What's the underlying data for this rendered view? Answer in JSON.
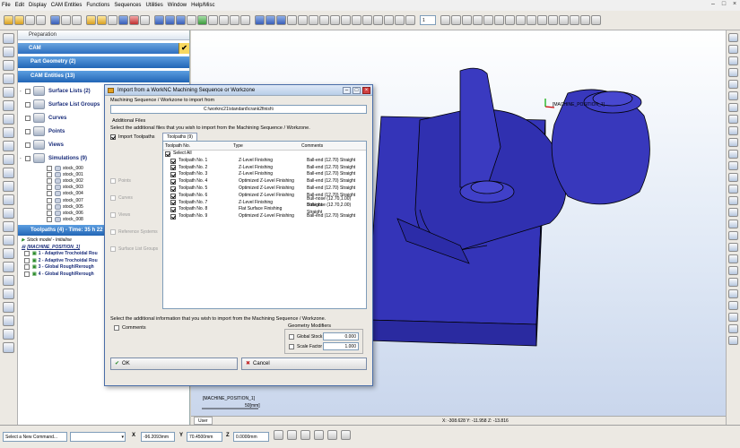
{
  "menu": [
    "File",
    "Edit",
    "Display",
    "CAM Entities",
    "Functions",
    "Sequences",
    "Utilities",
    "Window",
    "Help/Misc"
  ],
  "toolbar": {
    "zoom_value": "1"
  },
  "panel": {
    "preparation": "Preparation",
    "cam": "CAM",
    "part_geometry": "Part Geometry (2)",
    "cam_entities": "CAM Entities (13)",
    "tree": [
      {
        "label": "Surface Lists (2)"
      },
      {
        "label": "Surface List Groups"
      },
      {
        "label": "Curves"
      },
      {
        "label": "Points"
      },
      {
        "label": "Views"
      },
      {
        "label": "Simulations (9)"
      }
    ],
    "stocks": [
      "stock_000",
      "stock_001",
      "stock_002",
      "stock_003",
      "stock_004",
      "stock_007",
      "stock_005",
      "stock_006",
      "stock_008"
    ],
    "toolpaths_header": "Toolpaths (4) - Time: 35 h 22 min",
    "toolpaths": [
      {
        "label": "Stock model - Initialise"
      },
      {
        "label": "[MACHINE_POSITION_1]"
      },
      {
        "label": "1 - Adaptive Trochoidal Rou"
      },
      {
        "label": "2 - Adaptive Trochoidal Rou"
      },
      {
        "label": "3 - Global Rough/Rerough"
      },
      {
        "label": "4 - Global Rough/Rerough"
      }
    ]
  },
  "viewport": {
    "machine_pos_label": "[MACHINE_POSITION_1]",
    "machine_pos_label2": "[MACHINE_POSITION_1]",
    "scale_label": "50[mm]",
    "user_tab": "User",
    "coords": "X: -308.628   Y: -11.958   Z: -13.816",
    "colors": {
      "part": "#3434b8",
      "edges": "#000000"
    }
  },
  "dialog": {
    "title": "Import from a WorkNC Machining Sequence or Workzone",
    "path_label": "Machining Sequence / Workzone to import from",
    "path_value": "C:\\worknc21\\standard\\crank2finish\\",
    "additional_files": "Additional Files",
    "select_files_text": "Select the additional files that you wish to import from the Machining Sequence / Workzone.",
    "import_toolpaths": "Import Toolpaths",
    "other_options": [
      "Points",
      "Curves",
      "Views",
      "Reference Systems",
      "Surface List Groups"
    ],
    "tab_label": "Toolpaths (9)",
    "columns": [
      "Toolpath No.",
      "Type",
      "Comments"
    ],
    "select_all": "Select All",
    "rows": [
      {
        "no": "Toolpath No. 1",
        "type": "Z-Level Finishing",
        "comment": "Ball-end (12.70) Straight"
      },
      {
        "no": "Toolpath No. 2",
        "type": "Z-Level Finishing",
        "comment": "Ball-end (12.70) Straight"
      },
      {
        "no": "Toolpath No. 3",
        "type": "Z-Level Finishing",
        "comment": "Ball-end (12.70) Straight"
      },
      {
        "no": "Toolpath No. 4",
        "type": "Optimized Z-Level Finishing",
        "comment": "Ball-end (12.70) Straight"
      },
      {
        "no": "Toolpath No. 5",
        "type": "Optimized Z-Level Finishing",
        "comment": "Ball-end (12.70) Straight"
      },
      {
        "no": "Toolpath No. 6",
        "type": "Optimized Z-Level Finishing",
        "comment": "Ball-end (12.70) Straight"
      },
      {
        "no": "Toolpath No. 7",
        "type": "Z-Level Finishing",
        "comment": "Bull-nose (12.70,1.00) Straight"
      },
      {
        "no": "Toolpath No. 8",
        "type": "Flat Surface Finishing",
        "comment": "Bull-nose (12.70,2.00) Straight"
      },
      {
        "no": "Toolpath No. 9",
        "type": "Optimized Z-Level Finishing",
        "comment": "Ball-end (12.70) Straight"
      }
    ],
    "select_info_text": "Select the additional information that you wish to import from the Machining Sequence / Workzone.",
    "comments": "Comments",
    "geometry_modifiers": "Geometry Modifiers",
    "global_stock": "Global Stock",
    "global_stock_value": "0.000",
    "scale_factor": "Scale Factor",
    "scale_factor_value": "1.000",
    "ok": "OK",
    "cancel": "Cancel"
  },
  "bottom": {
    "command_placeholder": "Select a New Command...",
    "x_label": "X",
    "x_value": "-96.2093mm",
    "y_label": "Y",
    "y_value": "70.4500mm",
    "z_label": "Z",
    "z_value": "0.0000mm"
  }
}
